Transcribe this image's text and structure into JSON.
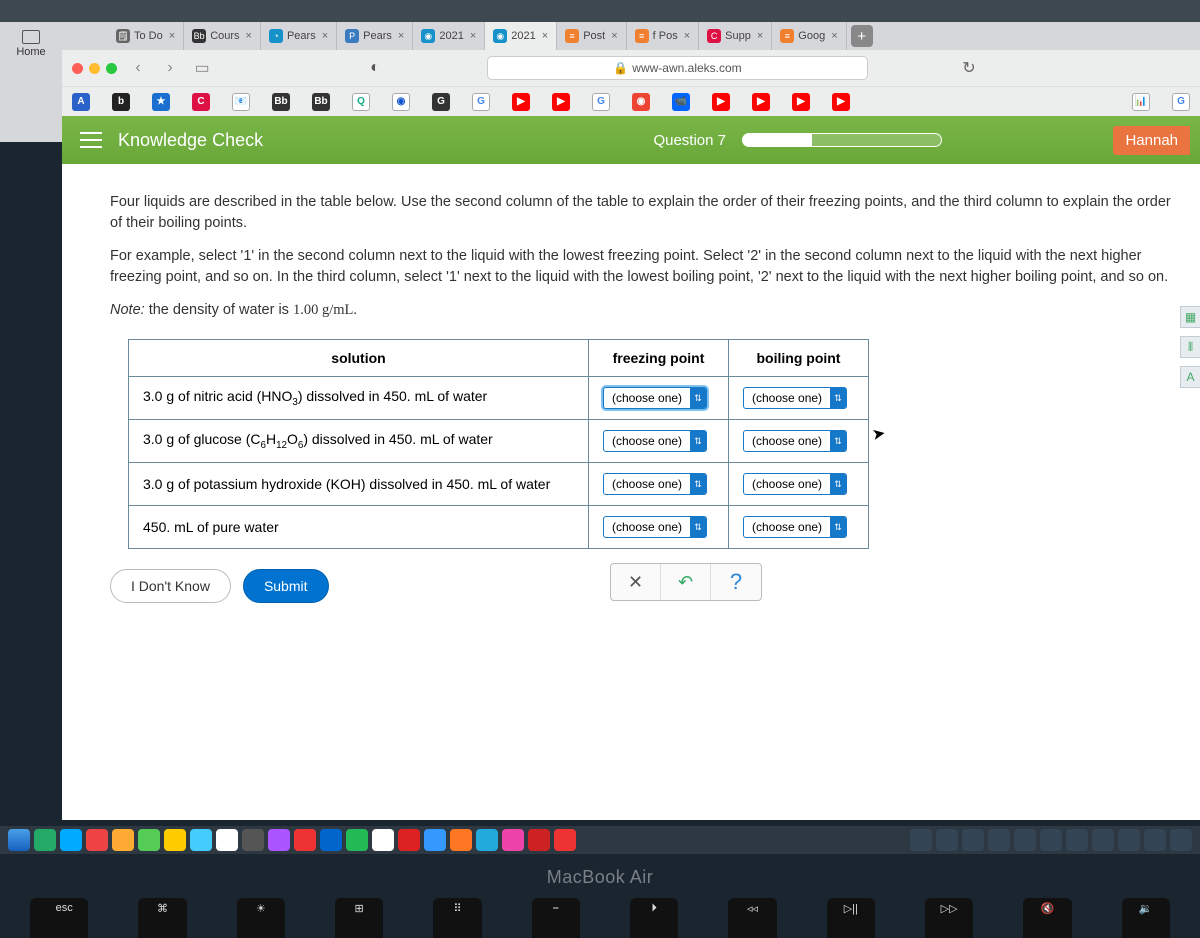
{
  "mac": {
    "home": "Home"
  },
  "tabs": [
    {
      "label": "To Do",
      "fav": "🗒",
      "close": "×"
    },
    {
      "label": "Cours",
      "fav": "Bb",
      "favbg": "#333",
      "close": "×"
    },
    {
      "label": "Pears",
      "fav": "◔",
      "favbg": "#1593c9",
      "close": "×"
    },
    {
      "label": "Pears",
      "fav": "P",
      "favbg": "#3a7bbf",
      "close": "×"
    },
    {
      "label": "2021",
      "fav": "◉",
      "favbg": "#1593c9",
      "close": "×"
    },
    {
      "label": "2021",
      "fav": "◉",
      "favbg": "#1593c9",
      "close": "×"
    },
    {
      "label": "Post",
      "fav": "≡",
      "favbg": "#f08030",
      "close": "×"
    },
    {
      "label": "f Pos",
      "fav": "≡",
      "favbg": "#f08030",
      "close": "×"
    },
    {
      "label": "Supp",
      "fav": "C",
      "favbg": "#d14",
      "close": "×"
    },
    {
      "label": "Goog",
      "fav": "≡",
      "favbg": "#f08030",
      "close": "×"
    }
  ],
  "newtab": "+",
  "url": {
    "lock": "🔒",
    "text": "www-awn.aleks.com"
  },
  "nav": {
    "back": "‹",
    "fwd": "›",
    "side": "▭",
    "reload": "↻",
    "shield": "◐"
  },
  "kc": {
    "title": "Knowledge Check",
    "question": "Question 7",
    "user": "Hannah"
  },
  "body": {
    "p1": "Four liquids are described in the table below. Use the second column of the table to explain the order of their freezing points, and the third column to explain the order of their boiling points.",
    "p2": "For example, select '1' in the second column next to the liquid with the lowest freezing point. Select '2' in the second column next to the liquid with the next higher freezing point, and so on. In the third column, select '1' next to the liquid with the lowest boiling point, '2' next to the liquid with the next higher boiling point, and so on.",
    "note_label": "Note:",
    "note_text": " the density of water is ",
    "density": "1.00 g/mL."
  },
  "table": {
    "h1": "solution",
    "h2": "freezing point",
    "h3": "boiling point",
    "rows": [
      {
        "pre": "3.0 g of nitric acid (HNO",
        "sub": "3",
        "post": ") dissolved in 450. mL of water"
      },
      {
        "pre": "3.0 g of glucose (C",
        "sub": "6",
        "mid": "H",
        "sub2": "12",
        "mid2": "O",
        "sub3": "6",
        "post": ") dissolved in 450. mL of water"
      },
      {
        "pre": "3.0 g of potassium hydroxide (KOH) dissolved in 450. mL of water"
      },
      {
        "pre": "450. mL of pure water"
      }
    ],
    "choose": "(choose one)",
    "arr": "⇅"
  },
  "toolbar": {
    "reset": "✕",
    "undo": "↶",
    "help": "?"
  },
  "footer": {
    "idk": "I Don't Know",
    "submit": "Submit"
  },
  "macbook": "MacBook Air",
  "keys": {
    "esc": "esc",
    "f3": "⌘",
    "f4": "☀",
    "f5": "⊞",
    "f6": "⠿",
    "f7": "⎯",
    "f8": "⏵",
    "f9": "◃◃",
    "f10": "▷||",
    "f11": "▷▷",
    "f12": "🔇",
    "f13": "🔉"
  }
}
